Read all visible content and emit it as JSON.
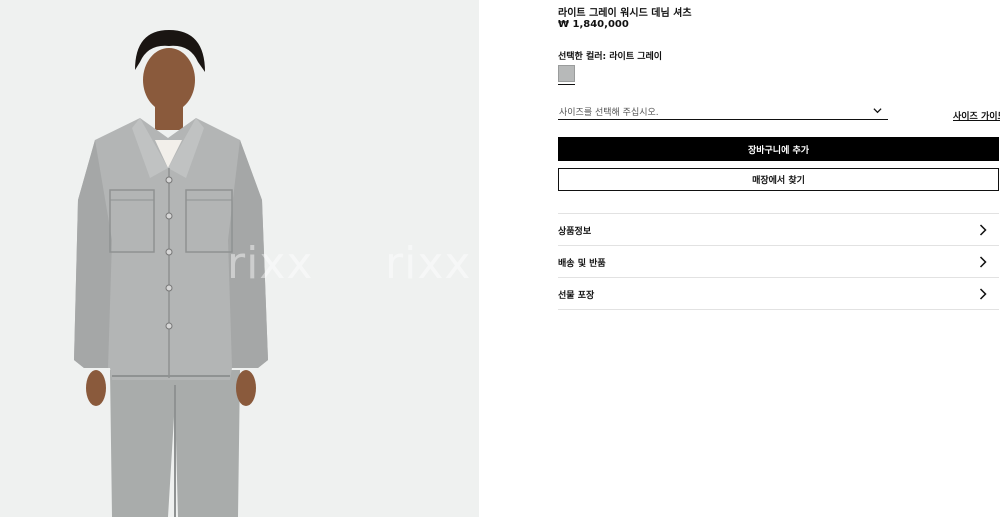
{
  "product": {
    "title": "라이트 그레이 워시드 데님 셔츠",
    "price": "₩ 1,840,000",
    "image_alt": "denim-shirt-model-photo",
    "watermark_text": "rixx"
  },
  "color": {
    "label": "선택한 컬러: 라이트 그레이",
    "swatch_hex": "#b7b9b9"
  },
  "size": {
    "placeholder": "사이즈를 선택해 주십시오.",
    "guide_label": "사이즈 가이드"
  },
  "actions": {
    "add_to_cart": "장바구니에 추가",
    "find_in_store": "매장에서 찾기"
  },
  "accordion": [
    {
      "label": "상품정보"
    },
    {
      "label": "배송 및 반품"
    },
    {
      "label": "선물 포장"
    }
  ],
  "colors": {
    "image_bg": "#eff1f0",
    "primary_button_bg": "#000000",
    "denim": "#a9abab"
  }
}
